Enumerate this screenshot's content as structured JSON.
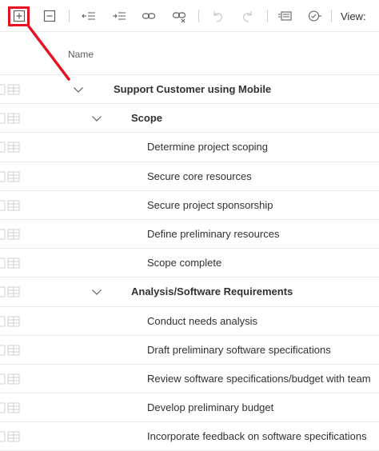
{
  "toolbar": {
    "buttons": [
      {
        "icon": "expand-all-icon"
      },
      {
        "icon": "collapse-all-icon"
      },
      {
        "icon": "outdent-icon"
      },
      {
        "icon": "indent-icon"
      },
      {
        "icon": "link-icon"
      },
      {
        "icon": "unlink-icon"
      },
      {
        "icon": "undo-icon"
      },
      {
        "icon": "redo-icon"
      },
      {
        "icon": "task-details-icon"
      },
      {
        "icon": "mark-complete-icon"
      }
    ],
    "view_label": "View:"
  },
  "header": {
    "name_column": "Name"
  },
  "tasks": [
    {
      "name": "Support Customer using Mobile",
      "level": 0,
      "summary": true
    },
    {
      "name": "Scope",
      "level": 1,
      "summary": true
    },
    {
      "name": "Determine project scoping",
      "level": 2,
      "summary": false
    },
    {
      "name": "Secure core resources",
      "level": 2,
      "summary": false
    },
    {
      "name": "Secure project sponsorship",
      "level": 2,
      "summary": false
    },
    {
      "name": "Define preliminary resources",
      "level": 2,
      "summary": false
    },
    {
      "name": "Scope complete",
      "level": 2,
      "summary": false
    },
    {
      "name": "Analysis/Software Requirements",
      "level": 1,
      "summary": true
    },
    {
      "name": "Conduct needs analysis",
      "level": 2,
      "summary": false
    },
    {
      "name": "Draft preliminary software specifications",
      "level": 2,
      "summary": false
    },
    {
      "name": "Review software specifications/budget with team",
      "level": 2,
      "summary": false
    },
    {
      "name": "Develop preliminary budget",
      "level": 2,
      "summary": false
    },
    {
      "name": "Incorporate feedback on software specifications",
      "level": 2,
      "summary": false
    }
  ],
  "colors": {
    "annotation": "#e81123",
    "text": "#323130",
    "divider": "#edebe9"
  }
}
